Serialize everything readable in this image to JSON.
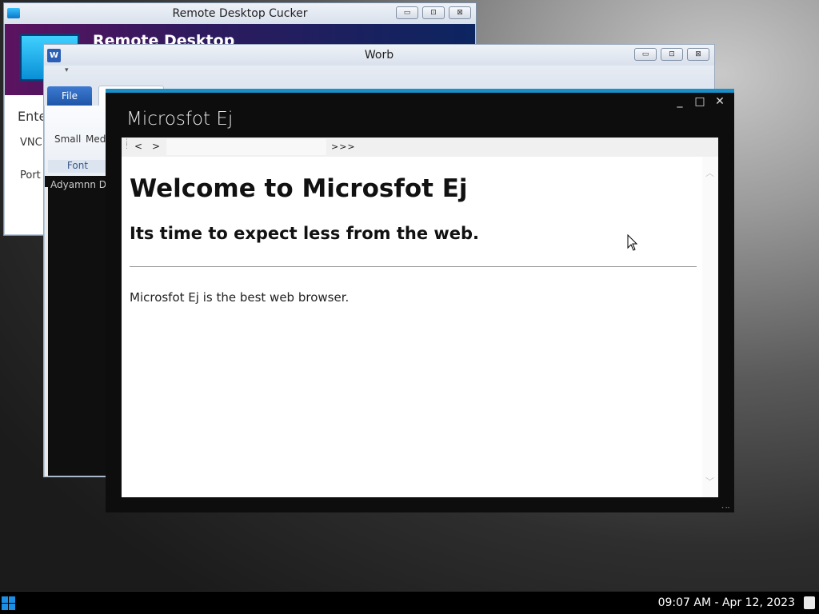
{
  "remote_desktop": {
    "title": "Remote Desktop Cucker",
    "banner_title": "Remote Desktop",
    "enter_label": "Ente",
    "vnc_label": "VNC",
    "port_label": "Port",
    "caption_buttons": [
      "▭",
      "⊡",
      "⊠"
    ]
  },
  "worb": {
    "title": "Worb",
    "app_icon_letter": "W",
    "qat_arrow": "▾",
    "file_tab": "File",
    "ribbon": {
      "small": "Small",
      "medium": "Medi",
      "group_label": "Font"
    },
    "author": "Adyamnn DE",
    "caption_buttons": [
      "▭",
      "⊡",
      "⊠"
    ]
  },
  "browser": {
    "title": "Microsfot Ej",
    "controls": {
      "minimize": "_",
      "maximize": "□",
      "close": "✕"
    },
    "toolbar": {
      "back": "<",
      "forward": ">",
      "more": ">>>"
    },
    "page": {
      "heading": "Welcome to Microsfot Ej",
      "subheading": "Its time to expect less from the web.",
      "body": "Microsfot Ej is the best web browser."
    },
    "scroll_up": "︿",
    "scroll_down": "﹀"
  },
  "taskbar": {
    "clock": "09:07 AM - Apr 12, 2023"
  },
  "colors": {
    "browser_accent": "#1b90c8",
    "start_icon": "#1b8fe6",
    "remote_banner_start": "#5c1360",
    "remote_banner_end": "#0c2560"
  }
}
